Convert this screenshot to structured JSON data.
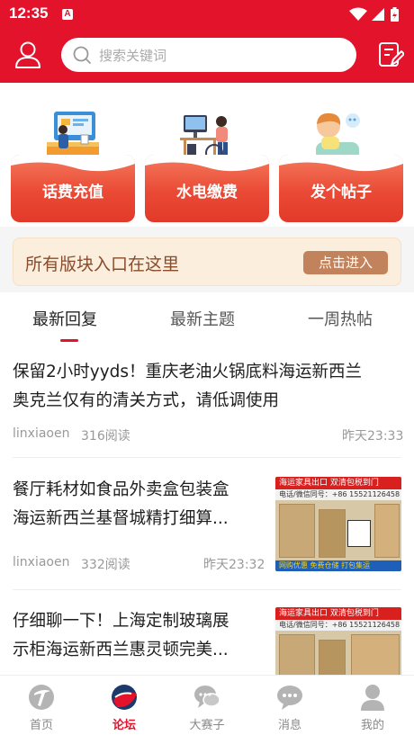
{
  "status_bar": {
    "time": "12:35",
    "app_badge": "A"
  },
  "header": {
    "search_placeholder": "搜索关键词"
  },
  "quick_actions": [
    {
      "label": "话费充值"
    },
    {
      "label": "水电缴费"
    },
    {
      "label": "发个帖子"
    }
  ],
  "banner": {
    "text": "所有版块入口在这里",
    "button": "点击进入"
  },
  "tabs": [
    {
      "label": "最新回复",
      "active": true
    },
    {
      "label": "最新主题",
      "active": false
    },
    {
      "label": "一周热帖",
      "active": false
    }
  ],
  "posts": [
    {
      "title_line1": "保留2小时yyds！重庆老油火锅底料海运新西兰",
      "title_line2": "奥克兰仅有的清关方式，请低调使用",
      "author": "linxiaoen",
      "reads": "316阅读",
      "time": "昨天23:33"
    },
    {
      "title_line1": "餐厅耗材如食品外卖盒包装盒",
      "title_line2": "海运新西兰基督城精打细算...",
      "author": "linxiaoen",
      "reads": "332阅读",
      "time": "昨天23:32",
      "thumb_top": "海运家具出口 双清包税到门",
      "thumb_sub": "电话/微信同号：+86 15521126458",
      "thumb_bottom": "网购优惠 免费仓储 打包集运"
    },
    {
      "title_line1": "仔细聊一下！上海定制玻璃展",
      "title_line2": "示柜海运新西兰惠灵顿完美...",
      "thumb_top": "海运家具出口 双清包税到门",
      "thumb_sub": "电话/微信同号：+86 15521126458"
    }
  ],
  "bottom_nav": [
    {
      "label": "首页",
      "icon": "home-logo-icon",
      "active": false
    },
    {
      "label": "论坛",
      "icon": "forum-icon",
      "active": true
    },
    {
      "label": "大赛子",
      "icon": "chat-bubbles-icon",
      "active": false
    },
    {
      "label": "消息",
      "icon": "message-icon",
      "active": false
    },
    {
      "label": "我的",
      "icon": "person-icon",
      "active": false
    }
  ],
  "colors": {
    "brand_red": "#e3132b",
    "banner_bg": "#fbeedd",
    "banner_btn": "#c1825c"
  }
}
